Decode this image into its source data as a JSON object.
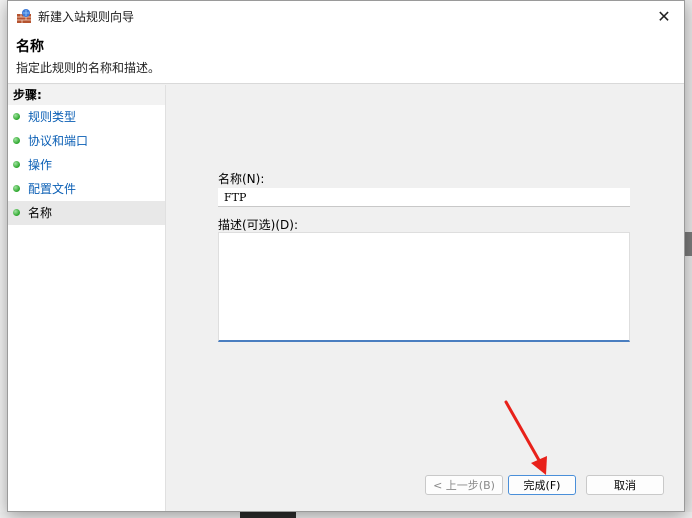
{
  "window": {
    "title": "新建入站规则向导",
    "close_glyph": "✕"
  },
  "header": {
    "title": "名称",
    "description": "指定此规则的名称和描述。"
  },
  "steps": {
    "heading": "步骤:",
    "items": [
      {
        "label": "规则类型",
        "current": false
      },
      {
        "label": "协议和端口",
        "current": false
      },
      {
        "label": "操作",
        "current": false
      },
      {
        "label": "配置文件",
        "current": false
      },
      {
        "label": "名称",
        "current": true
      }
    ]
  },
  "form": {
    "name_label": "名称(N):",
    "name_value": "FTP",
    "desc_label": "描述(可选)(D):",
    "desc_value": ""
  },
  "buttons": {
    "back": "< 上一步(B)",
    "finish": "完成(F)",
    "cancel": "取消"
  },
  "colors": {
    "link": "#0b5fb5",
    "annotation_arrow": "#e8211a",
    "step_dot": "#2aa52a"
  },
  "icons": {
    "app": "firewall-wall-icon",
    "close": "close-icon",
    "step": "green-dot-icon"
  }
}
